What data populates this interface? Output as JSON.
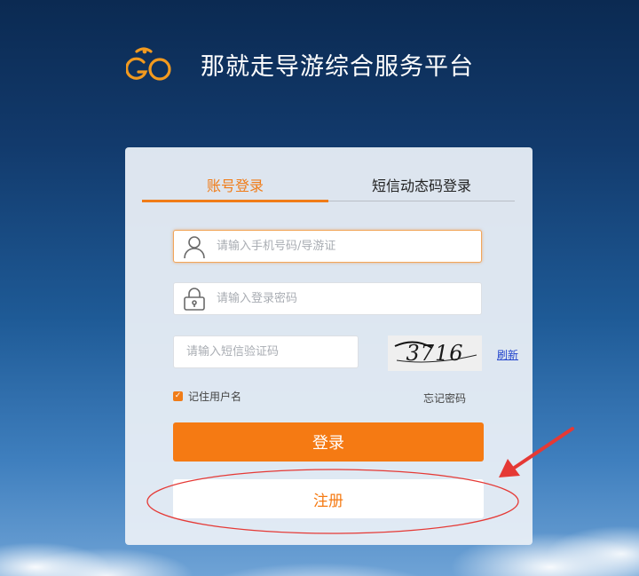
{
  "header": {
    "title": "那就走导游综合服务平台",
    "logo_icon": "go-logo"
  },
  "tabs": [
    {
      "label": "账号登录",
      "active": true
    },
    {
      "label": "短信动态码登录",
      "active": false
    }
  ],
  "form": {
    "account_placeholder": "请输入手机号码/导游证",
    "password_placeholder": "请输入登录密码",
    "sms_placeholder": "请输入短信验证码",
    "captcha_text": "3716",
    "refresh_label": "刷新",
    "remember_label": "记住用户名",
    "remember_checked": true,
    "forgot_label": "忘记密码",
    "login_label": "登录",
    "register_label": "注册"
  },
  "colors": {
    "accent": "#f57a13",
    "annotation": "#e53935"
  }
}
